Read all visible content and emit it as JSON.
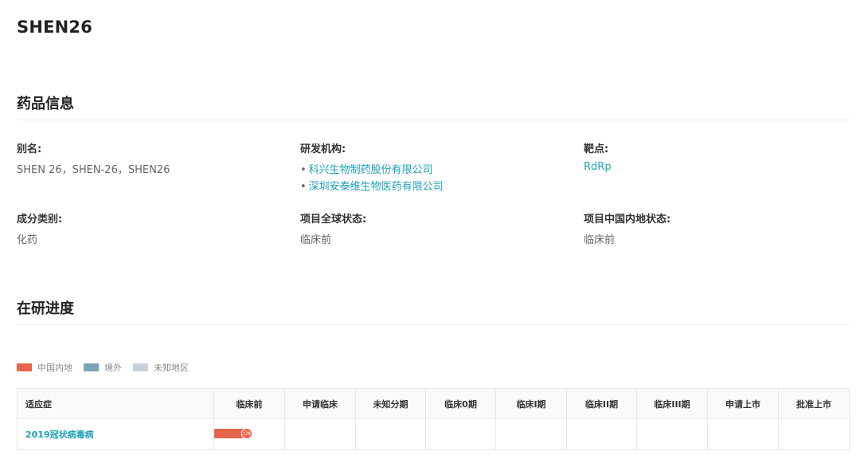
{
  "page": {
    "title": "SHEN26"
  },
  "drug_info": {
    "section_title": "药品信息",
    "alias_label": "别名:",
    "alias_value": "SHEN 26，SHEN-26，SHEN26",
    "org_label": "研发机构:",
    "orgs": [
      "科兴生物制药股份有限公司",
      "深圳安泰维生物医药有限公司"
    ],
    "target_label": "靶点:",
    "target_value": "RdRp",
    "category_label": "成分类别:",
    "category_value": "化药",
    "global_status_label": "项目全球状态:",
    "global_status_value": "临床前",
    "china_status_label": "项目中国内地状态:",
    "china_status_value": "临床前"
  },
  "progress": {
    "section_title": "在研进度",
    "legend": [
      {
        "label": "中国内地",
        "color": "#e8654d"
      },
      {
        "label": "境外",
        "color": "#7ba3b8"
      },
      {
        "label": "未知地区",
        "color": "#c7d0dc"
      }
    ],
    "columns": [
      "适应症",
      "临床前",
      "申请临床",
      "未知分期",
      "临床0期",
      "临床I期",
      "临床II期",
      "临床III期",
      "申请上市",
      "批准上市"
    ],
    "rows": [
      {
        "indication": "2019冠状病毒病",
        "stage": "临床前",
        "stage_index": 1,
        "stage_progress": 0.55,
        "region": "中国内地",
        "badge": "CN",
        "color": "#e8654d"
      }
    ]
  }
}
